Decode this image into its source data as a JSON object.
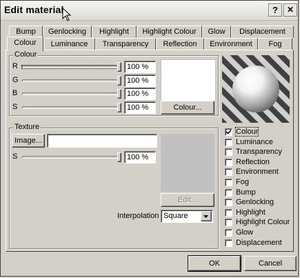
{
  "window": {
    "title": "Edit material",
    "help_label": "?",
    "close_label": "✕"
  },
  "tabs_row1": [
    "Bump",
    "Genlocking",
    "Highlight",
    "Highlight Colour",
    "Glow",
    "Displacement"
  ],
  "tabs_row2": [
    "Colour",
    "Luminance",
    "Transparency",
    "Reflection",
    "Environment",
    "Fog"
  ],
  "colour_group": {
    "label": "Colour",
    "rows": [
      {
        "label": "R",
        "value": "100 %",
        "level": 1.0
      },
      {
        "label": "G",
        "value": "100 %",
        "level": 1.0
      },
      {
        "label": "B",
        "value": "100 %",
        "level": 1.0
      },
      {
        "label": "S",
        "value": "100 %",
        "level": 1.0
      }
    ],
    "button_label": "Colour...",
    "swatch_color": "#ffffff"
  },
  "texture_group": {
    "label": "Texture",
    "image_button": "Image...",
    "image_path": "",
    "s_label": "S",
    "s_value": "100 %",
    "s_level": 1.0,
    "edit_button": "Edit...",
    "interpolation_label": "Interpolation",
    "interpolation_value": "Square"
  },
  "checklist": [
    {
      "label": "Colour",
      "checked": true
    },
    {
      "label": "Luminance",
      "checked": false
    },
    {
      "label": "Transparency",
      "checked": false
    },
    {
      "label": "Reflection",
      "checked": false
    },
    {
      "label": "Environment",
      "checked": false
    },
    {
      "label": "Fog",
      "checked": false
    },
    {
      "label": "Bump",
      "checked": false
    },
    {
      "label": "Genlocking",
      "checked": false
    },
    {
      "label": "Highlight",
      "checked": false
    },
    {
      "label": "Highlight Colour",
      "checked": false
    },
    {
      "label": "Glow",
      "checked": false
    },
    {
      "label": "Displacement",
      "checked": false
    }
  ],
  "footer": {
    "ok_label": "OK",
    "cancel_label": "Cancel"
  }
}
